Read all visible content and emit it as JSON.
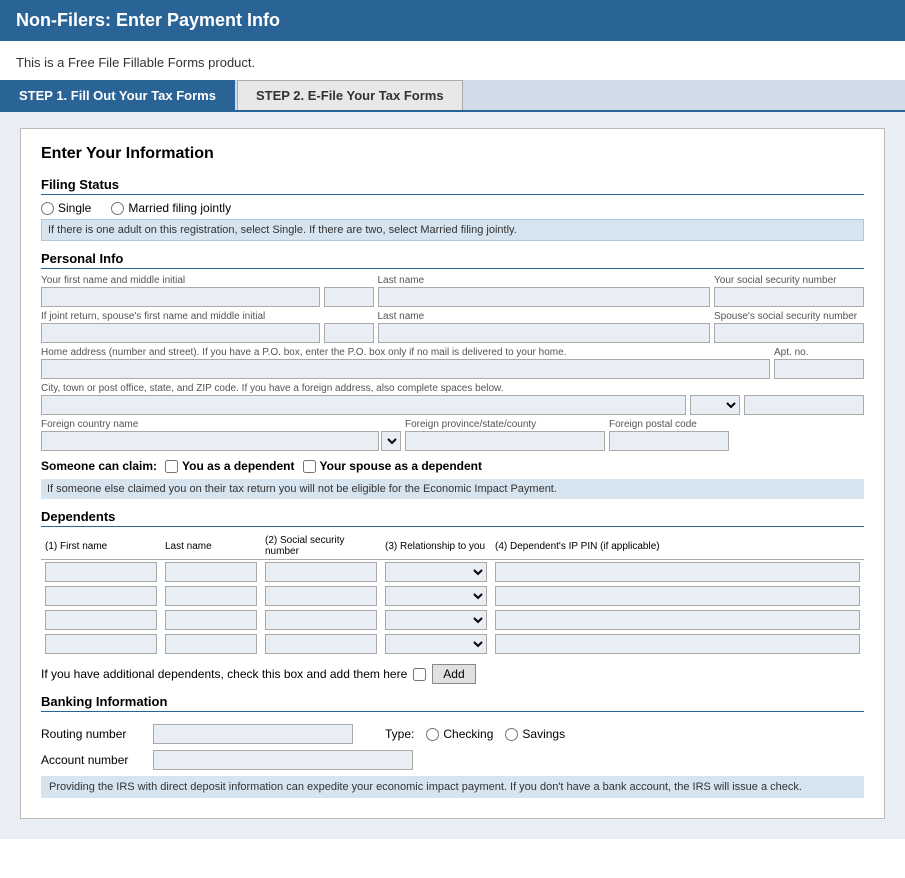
{
  "header": {
    "title": "Non-Filers: Enter Payment Info"
  },
  "subtitle": "This is a Free File Fillable Forms product.",
  "tabs": [
    {
      "label": "STEP 1. Fill Out Your Tax Forms",
      "active": true
    },
    {
      "label": "STEP 2. E-File Your Tax Forms",
      "active": false
    }
  ],
  "form": {
    "section_title": "Enter Your Information",
    "filing_status": {
      "label": "Filing Status",
      "options": [
        "Single",
        "Married filing jointly"
      ],
      "note": "If there is one adult on this registration, select Single. If there are two, select Married filing jointly."
    },
    "personal_info": {
      "label": "Personal Info",
      "fields": {
        "first_name_label": "Your first name and middle initial",
        "last_name_label": "Last name",
        "ssn_label": "Your social security number",
        "spouse_first_label": "If joint return, spouse's first name and middle initial",
        "spouse_last_label": "Last name",
        "spouse_ssn_label": "Spouse's social security number",
        "address_label": "Home address (number and street). If you have a P.O. box, enter the P.O. box only if no mail is delivered to your home.",
        "apt_label": "Apt. no.",
        "city_label": "City, town or post office, state, and ZIP code. If you have a foreign address, also complete spaces below.",
        "foreign_country_label": "Foreign country name",
        "foreign_province_label": "Foreign province/state/county",
        "foreign_postal_label": "Foreign postal code"
      }
    },
    "someone_claim": {
      "label": "Someone can claim:",
      "option1": "You as a dependent",
      "option2": "Your spouse as a dependent"
    },
    "warning": "If someone else claimed you on their tax return you will not be eligible for the Economic Impact Payment.",
    "dependents": {
      "label": "Dependents",
      "columns": [
        "(1) First name",
        "Last name",
        "(2) Social security number",
        "(3) Relationship to you",
        "(4) Dependent's IP PIN (if applicable)"
      ],
      "add_text": "If you have additional dependents, check this box and add them here",
      "add_button": "Add"
    },
    "banking": {
      "label": "Banking Information",
      "routing_label": "Routing number",
      "account_label": "Account number",
      "type_label": "Type:",
      "type_options": [
        "Checking",
        "Savings"
      ],
      "note": "Providing the IRS with direct deposit information can expedite your economic impact payment. If you don't have a bank account, the IRS will issue a check."
    }
  }
}
